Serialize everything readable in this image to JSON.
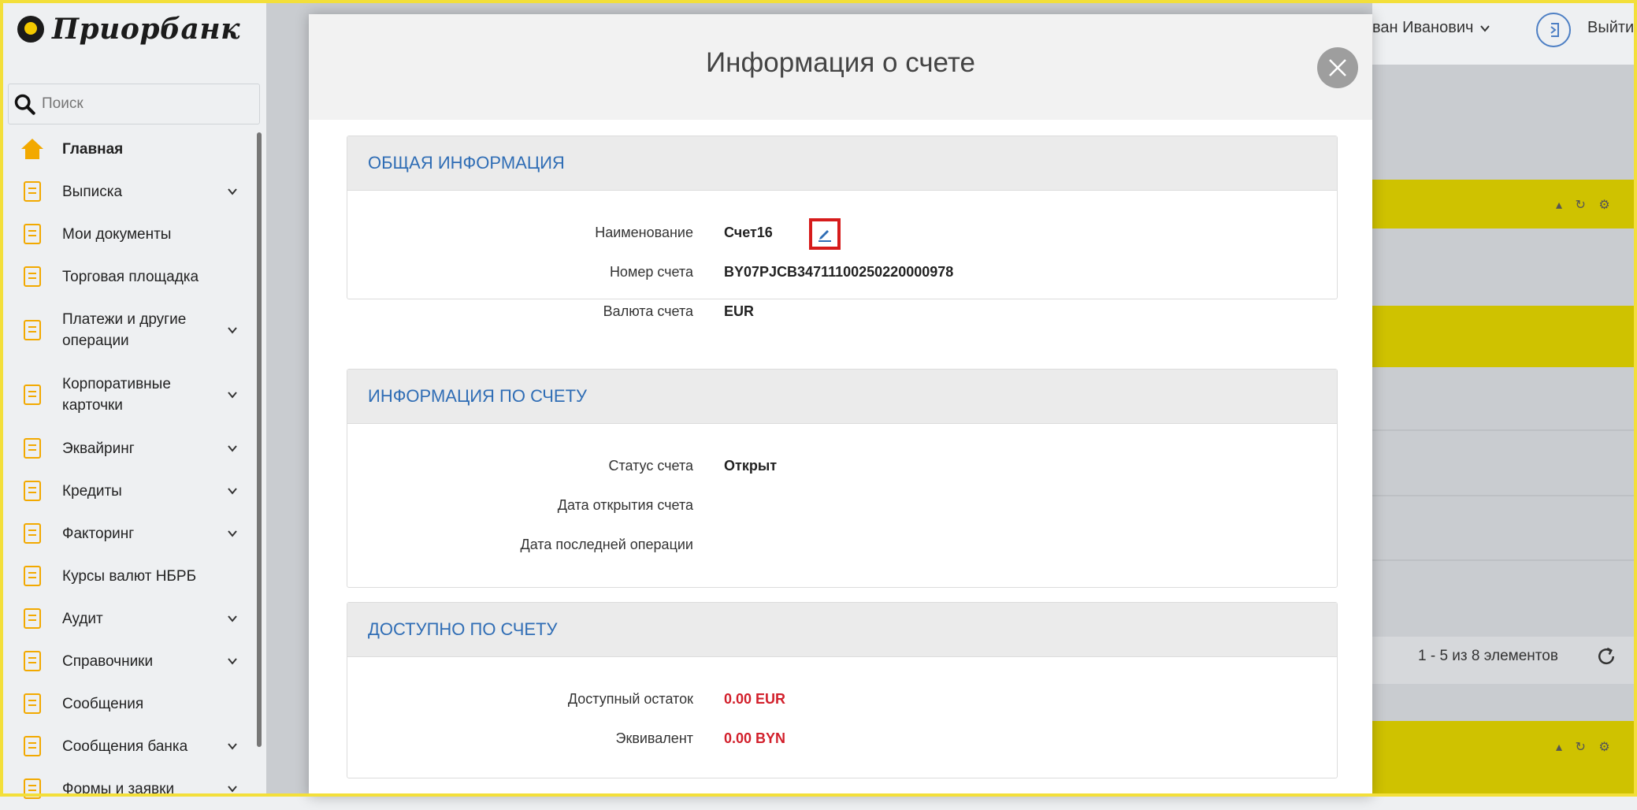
{
  "brand": {
    "name": "Приорбанк"
  },
  "search": {
    "placeholder": "Поиск"
  },
  "sidebar": {
    "items": [
      {
        "label": "Главная",
        "icon": "home-icon",
        "expandable": false,
        "active": true
      },
      {
        "label": "Выписка",
        "icon": "statement-icon",
        "expandable": true
      },
      {
        "label": "Мои документы",
        "icon": "documents-icon",
        "expandable": false
      },
      {
        "label": "Торговая площадка",
        "icon": "cart-icon",
        "expandable": false
      },
      {
        "label": "Платежи и другие операции",
        "icon": "wallet-icon",
        "expandable": true
      },
      {
        "label": "Корпоративные карточки",
        "icon": "card-icon",
        "expandable": true
      },
      {
        "label": "Эквайринг",
        "icon": "terminal-icon",
        "expandable": true
      },
      {
        "label": "Кредиты",
        "icon": "credit-icon",
        "expandable": true
      },
      {
        "label": "Факторинг",
        "icon": "pie-chart-icon",
        "expandable": true
      },
      {
        "label": "Курсы валют НБРБ",
        "icon": "exchange-icon",
        "expandable": false
      },
      {
        "label": "Аудит",
        "icon": "eye-icon",
        "expandable": true
      },
      {
        "label": "Справочники",
        "icon": "folder-icon",
        "expandable": true
      },
      {
        "label": "Сообщения",
        "icon": "message-icon",
        "expandable": false
      },
      {
        "label": "Сообщения банка",
        "icon": "bank-mail-icon",
        "expandable": true
      },
      {
        "label": "Формы и заявки",
        "icon": "form-icon",
        "expandable": true
      }
    ]
  },
  "header": {
    "user_name": "ван Иванович",
    "logout_label": "Выйти"
  },
  "background": {
    "pager_text": "1 - 5 из 8 элементов"
  },
  "modal": {
    "title": "Информация о счете",
    "sections": [
      {
        "title": "ОБЩАЯ ИНФОРМАЦИЯ",
        "rows": [
          {
            "label": "Наименование",
            "value": "Счет16",
            "editable": true
          },
          {
            "label": "Номер счета",
            "value": "BY07PJCB34711100250220000978"
          },
          {
            "label": "Валюта счета",
            "value": "EUR"
          }
        ]
      },
      {
        "title": "ИНФОРМАЦИЯ ПО СЧЕТУ",
        "rows": [
          {
            "label": "Статус счета",
            "value": "Открыт"
          },
          {
            "label": "Дата открытия счета",
            "value": ""
          },
          {
            "label": "Дата последней операции",
            "value": ""
          }
        ]
      },
      {
        "title": "ДОСТУПНО ПО СЧЕТУ",
        "rows": [
          {
            "label": "Доступный остаток",
            "value": "0.00 EUR",
            "highlight": true
          },
          {
            "label": "Эквивалент",
            "value": "0.00 BYN",
            "highlight": true
          }
        ]
      }
    ]
  },
  "colors": {
    "accent": "#2f6db5",
    "brand_yellow": "#f3df3a",
    "alert_red": "#d21f2b",
    "highlight_box": "#d61b1b"
  }
}
